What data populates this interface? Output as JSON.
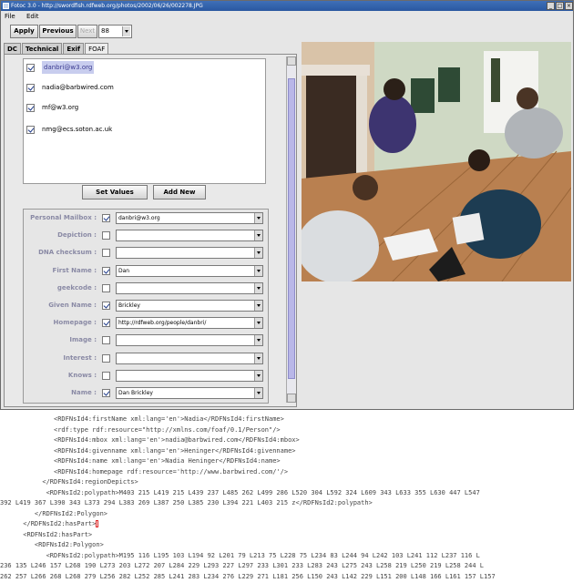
{
  "window": {
    "title": "Fotoc 3.0 - http://swordfish.rdfweb.org/photos/2002/06/26/002278.JPG",
    "menu": [
      "File",
      "Edit"
    ],
    "toolbar": {
      "apply": "Apply",
      "previous": "Previous",
      "next": "Next",
      "photo_number": "88"
    },
    "tabs": [
      {
        "label": "DC"
      },
      {
        "label": "Technical"
      },
      {
        "label": "Exif"
      },
      {
        "label": "FOAF"
      }
    ],
    "active_tab": "FOAF"
  },
  "people_list": [
    {
      "text": "danbri@w3.org",
      "checked": true,
      "selected": true
    },
    {
      "text": "nadia@barbwired.com",
      "checked": true,
      "selected": false
    },
    {
      "text": "mf@w3.org",
      "checked": true,
      "selected": false
    },
    {
      "text": "nmg@ecs.soton.ac.uk",
      "checked": true,
      "selected": false
    }
  ],
  "buttons": {
    "set_values": "Set Values",
    "add_new": "Add New"
  },
  "form": [
    {
      "label": "Personal Mailbox :",
      "checked": true,
      "value": "danbri@w3.org"
    },
    {
      "label": "Depiction :",
      "checked": false,
      "value": ""
    },
    {
      "label": "DNA checksum :",
      "checked": false,
      "value": ""
    },
    {
      "label": "First Name :",
      "checked": true,
      "value": "Dan"
    },
    {
      "label": "geekcode :",
      "checked": false,
      "value": ""
    },
    {
      "label": "Given Name :",
      "checked": true,
      "value": "Brickley"
    },
    {
      "label": "Homepage :",
      "checked": true,
      "value": "http://rdfweb.org/people/danbri/"
    },
    {
      "label": "Image :",
      "checked": false,
      "value": ""
    },
    {
      "label": "Interest :",
      "checked": false,
      "value": ""
    },
    {
      "label": "Knows :",
      "checked": false,
      "value": ""
    },
    {
      "label": "Name :",
      "checked": true,
      "value": "Dan Brickley"
    }
  ],
  "code_lines": [
    "              <RDFNsId4:firstName xml:lang='en'>Nadia</RDFNsId4:firstName>",
    "              <rdf:type rdf:resource=\"http://xmlns.com/foaf/0.1/Person\"/>",
    "              <RDFNsId4:mbox xml:lang='en'>nadia@barbwired.com</RDFNsId4:mbox>",
    "              <RDFNsId4:givenname xml:lang='en'>Heninger</RDFNsId4:givenname>",
    "              <RDFNsId4:name xml:lang='en'>Nadia Heninger</RDFNsId4:name>",
    "              <RDFNsId4:homepage rdf:resource='http://www.barbwired.com/'/>",
    "           </RDFNsId4:regionDepicts>",
    "            <RDFNsId2:polypath>M403 215 L419 215 L439 237 L485 262 L499 286 L520 304 L592 324 L609 343 L633 355 L630 447 L547",
    "392 L419 367 L390 343 L373 294 L383 269 L387 250 L385 230 L394 221 L403 215 z</RDFNsId2:polypath>",
    "         </RDFNsId2:Polygon>",
    "      </RDFNsId2:hasPart>",
    "      <RDFNsId2:hasPart>",
    "         <RDFNsId2:Polygon>",
    "            <RDFNsId2:polypath>M195 116 L195 103 L194 92 L201 79 L213 75 L228 75 L234 83 L244 94 L242 103 L241 112 L237 116 L",
    "236 135 L246 157 L268 190 L273 203 L272 207 L284 229 L293 227 L297 233 L301 233 L283 243 L275 243 L258 219 L250 219 L258 244 L",
    "262 257 L266 268 L268 279 L256 282 L252 285 L241 283 L234 276 L229 271 L181 256 L150 243 L142 229 L151 200 L148 166 L161 157 L157"
  ]
}
